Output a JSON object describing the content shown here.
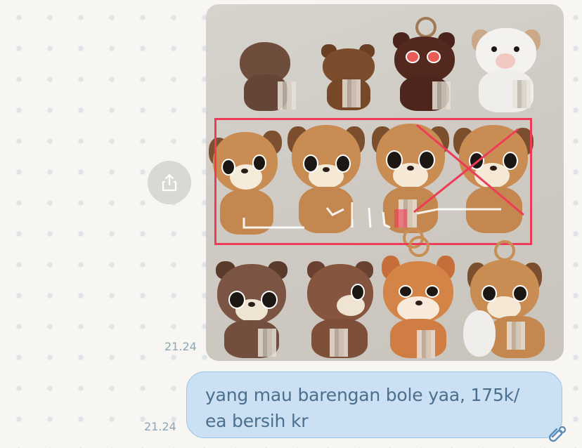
{
  "incoming": {
    "time": "21.24",
    "image_description_icons": [
      "share-icon"
    ]
  },
  "outgoing": {
    "text_line_1": "yang mau barengan bole yaa, 175k/",
    "text_line_2": "ea bersih kr",
    "time": "21.24"
  },
  "colors": {
    "background": "#f7f6f3",
    "bubble": "#cbe0f3",
    "bubble_text": "#4b6f8c",
    "timestamp": "#8ba5b4",
    "highlight": "#ee3b57"
  }
}
